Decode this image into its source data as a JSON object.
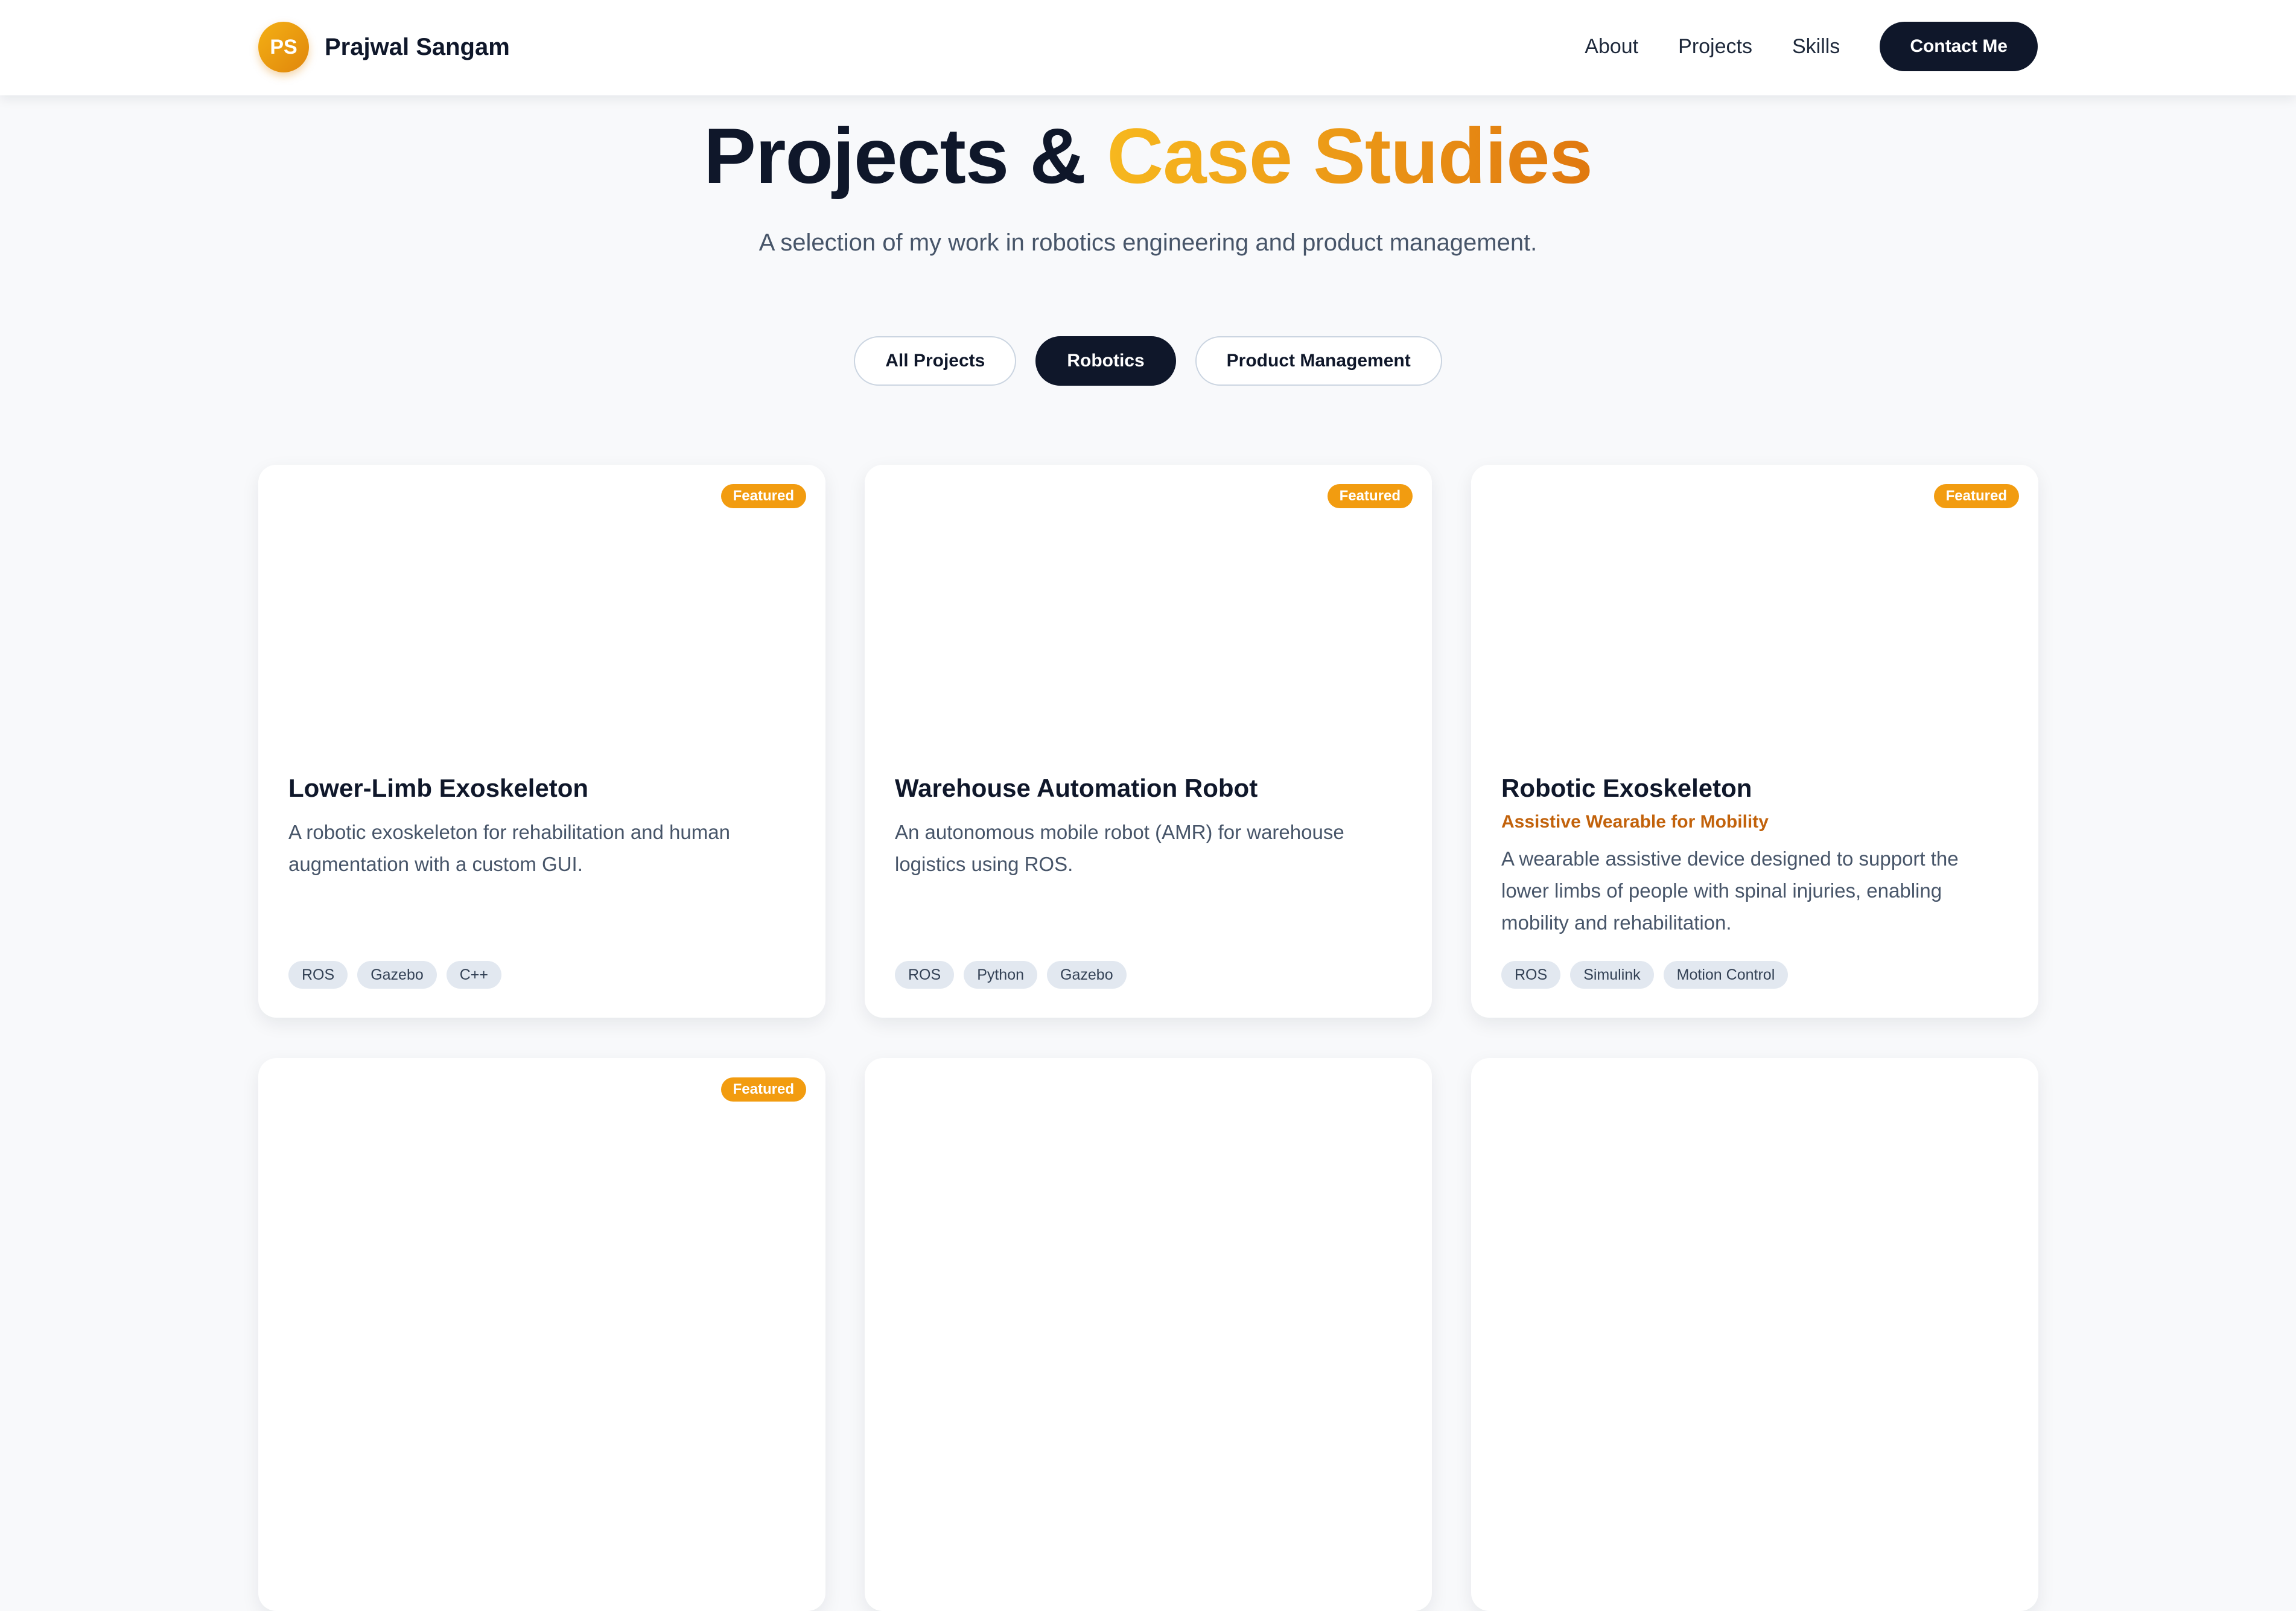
{
  "header": {
    "logo_initials": "PS",
    "brand_name": "Prajwal Sangam",
    "nav": [
      {
        "label": "About"
      },
      {
        "label": "Projects"
      },
      {
        "label": "Skills"
      }
    ],
    "contact_label": "Contact Me"
  },
  "hero": {
    "title_main": "Projects & ",
    "title_accent": "Case Studies",
    "subtitle": "A selection of my work in robotics engineering and product management."
  },
  "filters": {
    "items": [
      {
        "label": "All Projects",
        "active": false
      },
      {
        "label": "Robotics",
        "active": true
      },
      {
        "label": "Product Management",
        "active": false
      }
    ]
  },
  "projects": [
    {
      "featured_label": "Featured",
      "title": "Lower-Limb Exoskeleton",
      "tagline": "",
      "description": "A robotic exoskeleton for rehabilitation and human augmentation with a custom GUI.",
      "tags": [
        "ROS",
        "Gazebo",
        "C++"
      ]
    },
    {
      "featured_label": "Featured",
      "title": "Warehouse Automation Robot",
      "tagline": "",
      "description": "An autonomous mobile robot (AMR) for warehouse logistics using ROS.",
      "tags": [
        "ROS",
        "Python",
        "Gazebo"
      ]
    },
    {
      "featured_label": "Featured",
      "title": "Robotic Exoskeleton",
      "tagline": "Assistive Wearable for Mobility",
      "description": "A wearable assistive device designed to support the lower limbs of people with spinal injuries, enabling mobility and rehabilitation.",
      "tags": [
        "ROS",
        "Simulink",
        "Motion Control"
      ]
    },
    {
      "featured_label": "Featured"
    }
  ],
  "colors": {
    "accent_start": "#f7b81e",
    "accent_end": "#e0780f",
    "dark": "#0f172a",
    "badge": "#f29c10",
    "tagline": "#c2620b"
  }
}
